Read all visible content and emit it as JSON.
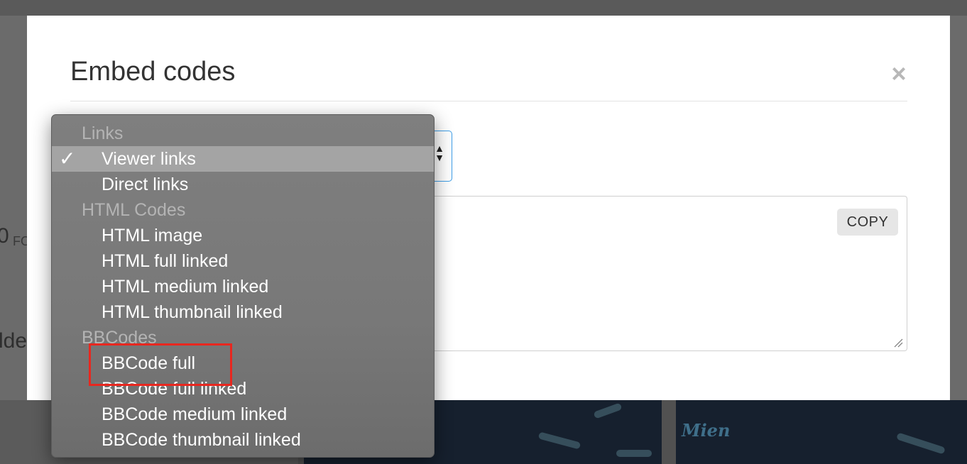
{
  "background": {
    "ghost_number": "0",
    "ghost_label": "FO",
    "ghost_word": "lde",
    "thumbnail_script_text": "Mien"
  },
  "modal": {
    "title": "Embed codes",
    "close_label": "×",
    "copy_label": "COPY",
    "select_arrows": "▲\n▼"
  },
  "dropdown": {
    "check_mark": "✓",
    "groups": [
      {
        "label": "Links",
        "items": [
          {
            "label": "Viewer links",
            "selected": true
          },
          {
            "label": "Direct links",
            "selected": false
          }
        ]
      },
      {
        "label": "HTML Codes",
        "items": [
          {
            "label": "HTML image",
            "selected": false
          },
          {
            "label": "HTML full linked",
            "selected": false
          },
          {
            "label": "HTML medium linked",
            "selected": false
          },
          {
            "label": "HTML thumbnail linked",
            "selected": false
          }
        ]
      },
      {
        "label": "BBCodes",
        "items": [
          {
            "label": "BBCode full",
            "selected": false,
            "highlighted": true
          },
          {
            "label": "BBCode full linked",
            "selected": false
          },
          {
            "label": "BBCode medium linked",
            "selected": false
          },
          {
            "label": "BBCode thumbnail linked",
            "selected": false
          }
        ]
      }
    ]
  },
  "colors": {
    "focus_border": "#3d9ee8",
    "highlight_annotation": "#e8271f",
    "menu_selected_bg": "#a4a4a4"
  }
}
